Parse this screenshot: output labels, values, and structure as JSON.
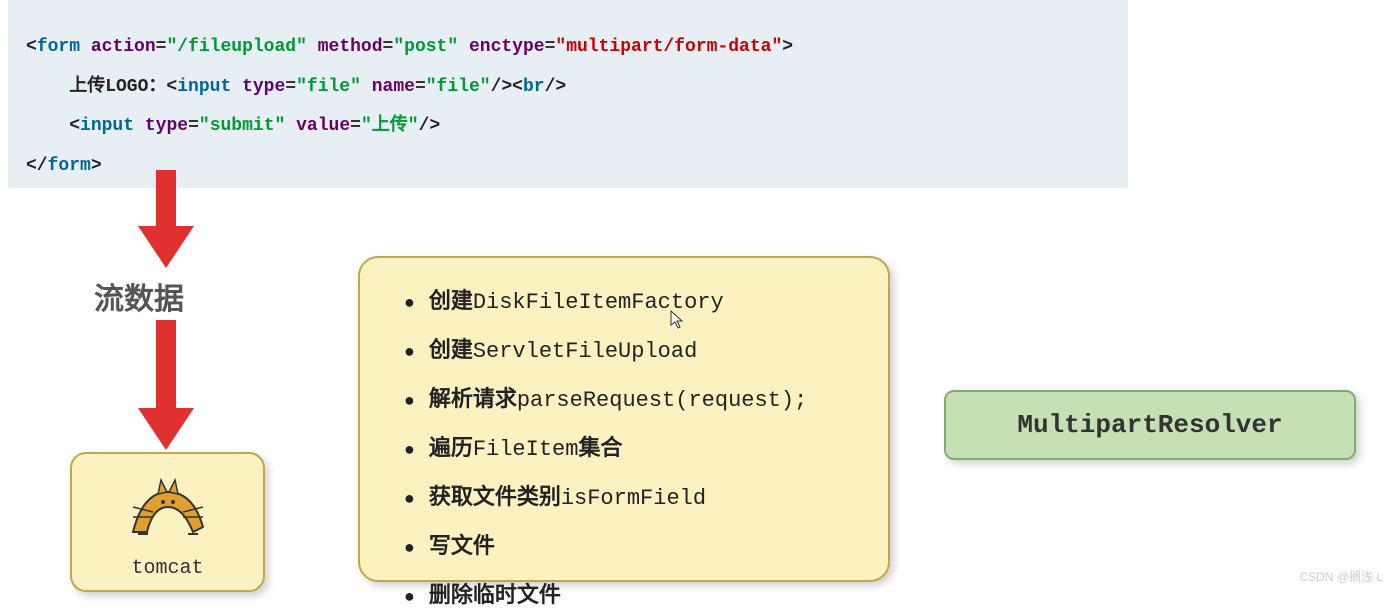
{
  "code": {
    "line1": {
      "p1": "<",
      "tag1": "form",
      "sp": " ",
      "a1": "action",
      "eq": "=",
      "v1": "\"/fileupload\"",
      "a2": "method",
      "v2": "\"post\"",
      "a3": "enctype",
      "v3": "\"multipart/form-data\"",
      "close": ">"
    },
    "line2": {
      "txt": "    上传LOGO：",
      "open": "<",
      "tag": "input",
      "a1": "type",
      "v1": "\"file\"",
      "a2": "name",
      "v2": "\"file\"",
      "close": "/><",
      "tag2": "br",
      "close2": "/>"
    },
    "line3": {
      "indent": "    ",
      "open": "<",
      "tag": "input",
      "a1": "type",
      "v1": "\"submit\"",
      "a2": "value",
      "v2": "\"上传\"",
      "close": "/>"
    },
    "line4": {
      "open": "</",
      "tag": "form",
      "close": ">"
    }
  },
  "stream_label": "流数据",
  "tomcat_label": "tomcat",
  "steps": [
    {
      "bold": "创建",
      "mono": "DiskFileItemFactory"
    },
    {
      "bold": "创建",
      "mono": "ServletFileUpload"
    },
    {
      "bold": "解析请求",
      "mono": "parseRequest(request);"
    },
    {
      "bold": "遍历",
      "mono": "FileItem",
      "bold2": "集合"
    },
    {
      "bold": "获取文件类别",
      "mono": "isFormField"
    },
    {
      "bold": "写文件",
      "mono": ""
    },
    {
      "bold": "删除临时文件",
      "mono": ""
    }
  ],
  "right_box": "MultipartResolver",
  "watermark": "CSDN @搁浅  L"
}
